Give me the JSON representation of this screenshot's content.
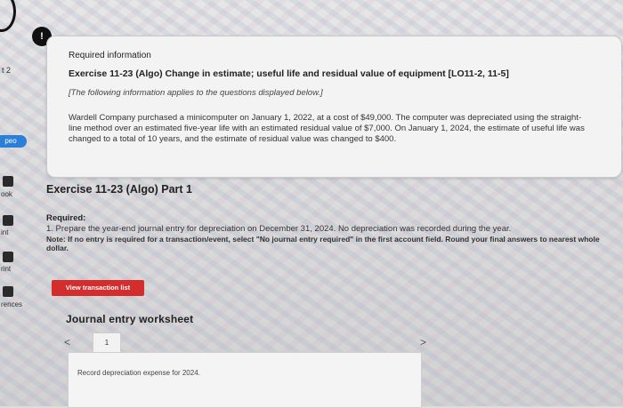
{
  "left_rail": {
    "number": "t 2",
    "pill": "peo",
    "labels": [
      "ook",
      "int",
      "rint",
      "rences"
    ]
  },
  "info": {
    "badge": "!",
    "title": "Required information",
    "exercise": "Exercise 11-23 (Algo) Change in estimate; useful life and residual value of equipment [LO11-2, 11-5]",
    "italic": "[The following information applies to the questions displayed below.]",
    "body": "Wardell Company purchased a minicomputer on January 1, 2022, at a cost of $49,000. The computer was depreciated using the straight-line method over an estimated five-year life with an estimated residual value of $7,000. On January 1, 2024, the estimate of useful life was changed to a total of 10 years, and the estimate of residual value was changed to $400."
  },
  "part": {
    "title": "Exercise 11-23 (Algo) Part 1",
    "required_label": "Required:",
    "required_text": "1. Prepare the year-end journal entry for depreciation on December 31, 2024. No depreciation was recorded during the year.",
    "note": "Note: If no entry is required for a transaction/event, select \"No journal entry required\" in the first account field. Round your final answers to nearest whole dollar."
  },
  "buttons": {
    "view_txn": "View transaction list"
  },
  "journal": {
    "title": "Journal entry worksheet",
    "prev": "<",
    "tab": "1",
    "next": ">",
    "instruction": "Record depreciation expense for 2024."
  }
}
